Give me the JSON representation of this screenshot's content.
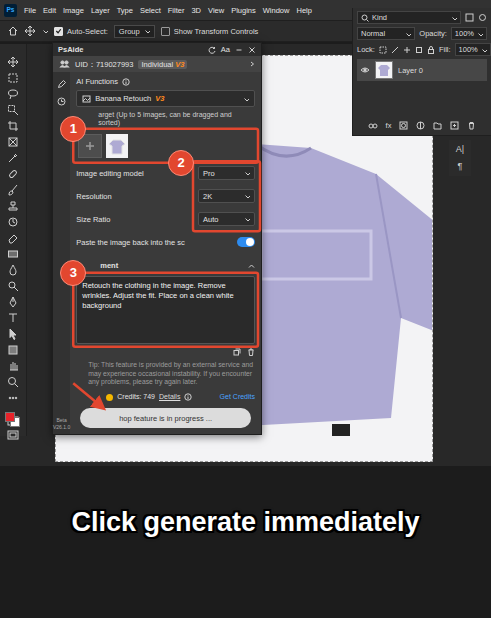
{
  "app": {
    "logo": "Ps"
  },
  "menu": [
    "File",
    "Edit",
    "Image",
    "Layer",
    "Type",
    "Select",
    "Filter",
    "3D",
    "View",
    "Plugins",
    "Window",
    "Help"
  ],
  "options_bar": {
    "auto_select": {
      "label": "Auto-Select:",
      "checked": true
    },
    "target": "Group",
    "transform_controls": {
      "label": "Show Transform Controls",
      "checked": false
    }
  },
  "toolbar": {
    "swatches": [
      {
        "name": "foreground",
        "color": "#e8232a"
      },
      {
        "name": "background",
        "color": "#ffffff"
      }
    ]
  },
  "layers_panel": {
    "filter": "Kind",
    "blend_mode": "Normal",
    "opacity_label": "Opacity:",
    "opacity": "100%",
    "lock_label": "Lock:",
    "fill_label": "Fill:",
    "fill": "100%",
    "layers": [
      {
        "name": "Layer 0",
        "visible": true,
        "selected": true
      }
    ],
    "effects_button": "fx"
  },
  "right_dock": [
    "A|",
    "¶"
  ],
  "plugin": {
    "title": "PsAide",
    "header_buttons": [
      "Aa"
    ],
    "account": {
      "uid": "UID：719027993",
      "plan": "Individual",
      "plan_version": "V3"
    },
    "section": "AI Functions",
    "function": {
      "name": "Banana Retouch",
      "version": "V3"
    },
    "target_label": "arget (Up to 5 images, can be dragged and sorted)",
    "settings": [
      {
        "kind": "select",
        "label": "Image editing model",
        "value": "Pro"
      },
      {
        "kind": "select",
        "label": "Resolution",
        "value": "2K"
      },
      {
        "kind": "select",
        "label": "Size Ratio",
        "value": "Auto"
      },
      {
        "kind": "toggle",
        "label": "Paste the image back into the sc",
        "on": true
      }
    ],
    "prompt_label": "ment",
    "prompt_expanded": true,
    "prompt": "Retouch the clothing in the image. Remove wrinkles. Adjust the fit. Place on a clean white background",
    "tip": "Tip: This feature is provided by an external service and may experience occasional instability. If you encounter any problems, please try again later.",
    "credits": {
      "label": "Credits: 749",
      "details": "Details",
      "get": "Get Credits"
    },
    "generate_button": "hop feature is in progress ...",
    "build": {
      "channel": "Beta",
      "version": "V26.1.0"
    }
  },
  "annotations": [
    {
      "label": "1"
    },
    {
      "label": "2"
    },
    {
      "label": "3"
    }
  ],
  "caption": "Click generate immediately"
}
